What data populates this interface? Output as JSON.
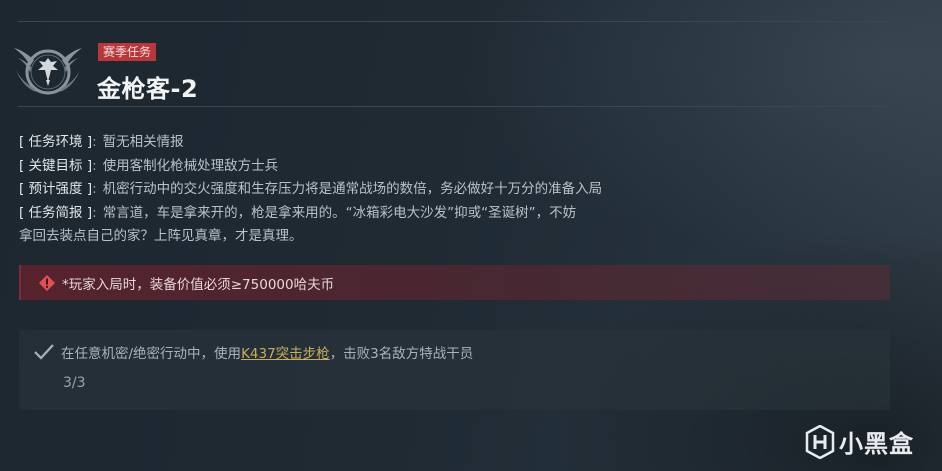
{
  "header": {
    "tag": "赛季任务",
    "title": "金枪客-2"
  },
  "info": [
    {
      "key": "[ 任务环境 ]",
      "value": "暂无相关情报"
    },
    {
      "key": "[ 关键目标 ]",
      "value": "使用客制化枪械处理敌方士兵"
    },
    {
      "key": "[ 预计强度 ]",
      "value": "机密行动中的交火强度和生存压力将是通常战场的数倍，务必做好十万分的准备入局"
    },
    {
      "key": "[ 任务简报 ]",
      "value": "常言道，车是拿来开的，枪是拿来用的。“冰箱彩电大沙发”抑或“圣诞树”，不妨"
    }
  ],
  "info_continuation": "拿回去装点自己的家？上阵见真章，才是真理。",
  "warning": {
    "icon": "warning-diamond-icon",
    "text": "*玩家入局时，装备价值必须≥750000哈夫币",
    "color": "#e14f56"
  },
  "task": {
    "status_icon": "check-icon",
    "prefix": "在任意机密/绝密行动中，使用",
    "weapon": "K437突击步枪",
    "suffix": "，击败3名敌方特战干员",
    "progress": "3/3",
    "link_color": "#c9ad5c"
  },
  "watermark": {
    "text": "小黑盒"
  }
}
